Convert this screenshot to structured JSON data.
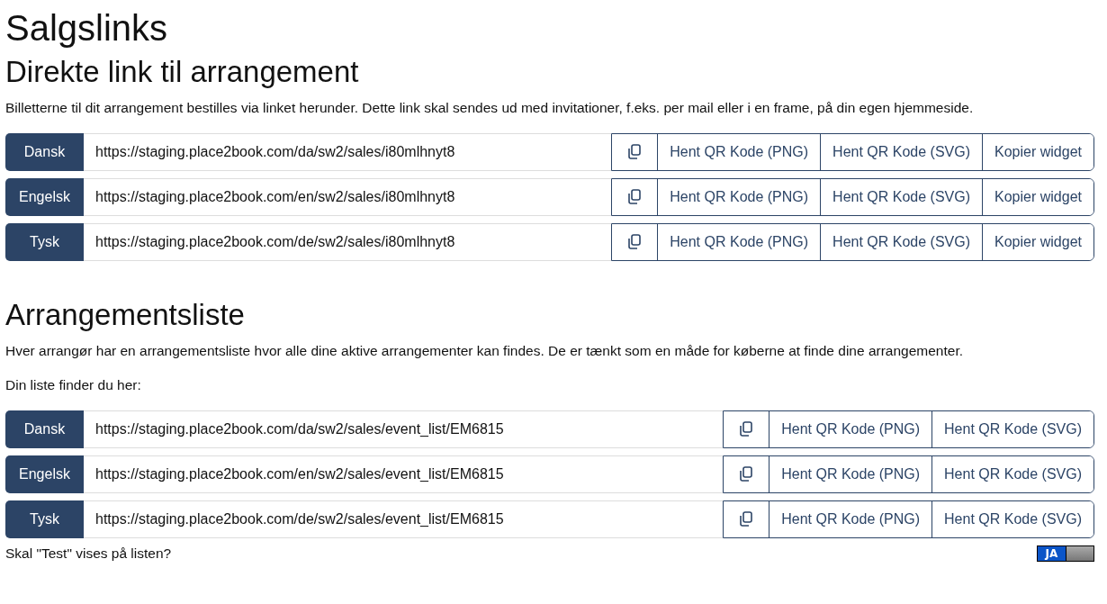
{
  "title": "Salgslinks",
  "sections": [
    {
      "heading": "Direkte link til arrangement",
      "paragraphs": [
        "Billetterne til dit arrangement bestilles via linket herunder. Dette link skal sendes ud med invitationer, f.eks. per mail eller i en frame, på din egen hjemmeside."
      ],
      "rows": [
        {
          "language": "Dansk",
          "url": "https://staging.place2book.com/da/sw2/sales/i80mlhnyt8",
          "buttons": [
            "Hent QR Kode (PNG)",
            "Hent QR Kode (SVG)",
            "Kopier widget"
          ]
        },
        {
          "language": "Engelsk",
          "url": "https://staging.place2book.com/en/sw2/sales/i80mlhnyt8",
          "buttons": [
            "Hent QR Kode (PNG)",
            "Hent QR Kode (SVG)",
            "Kopier widget"
          ]
        },
        {
          "language": "Tysk",
          "url": "https://staging.place2book.com/de/sw2/sales/i80mlhnyt8",
          "buttons": [
            "Hent QR Kode (PNG)",
            "Hent QR Kode (SVG)",
            "Kopier widget"
          ]
        }
      ]
    },
    {
      "heading": "Arrangementsliste",
      "paragraphs": [
        "Hver arrangør har en arrangementsliste hvor alle dine aktive arrangementer kan findes. De er tænkt som en måde for køberne at finde dine arrangementer.",
        "Din liste finder du her:"
      ],
      "rows": [
        {
          "language": "Dansk",
          "url": "https://staging.place2book.com/da/sw2/sales/event_list/EM6815",
          "buttons": [
            "Hent QR Kode (PNG)",
            "Hent QR Kode (SVG)"
          ]
        },
        {
          "language": "Engelsk",
          "url": "https://staging.place2book.com/en/sw2/sales/event_list/EM6815",
          "buttons": [
            "Hent QR Kode (PNG)",
            "Hent QR Kode (SVG)"
          ]
        },
        {
          "language": "Tysk",
          "url": "https://staging.place2book.com/de/sw2/sales/event_list/EM6815",
          "buttons": [
            "Hent QR Kode (PNG)",
            "Hent QR Kode (SVG)"
          ]
        }
      ]
    }
  ],
  "footer": {
    "question": "Skal \"Test\" vises på listen?",
    "toggle": {
      "label": "JA",
      "on": true
    }
  }
}
